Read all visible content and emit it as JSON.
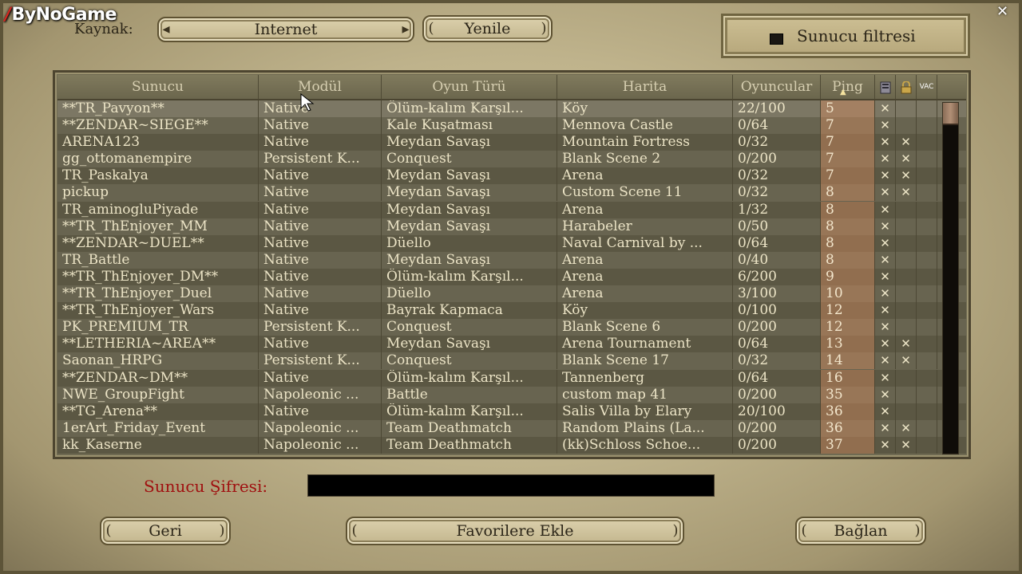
{
  "watermark": "ByNoGame",
  "window_close_glyph": "✕",
  "header": {
    "source_label": "Kaynak:",
    "source_value": "Internet",
    "refresh_label": "Yenile",
    "filter_label": "Sunucu filtresi",
    "filter_checked": true
  },
  "table": {
    "columns": {
      "server": "Sunucu",
      "module": "Modül",
      "game_type": "Oyun Türü",
      "map": "Harita",
      "players": "Oyuncular",
      "ping": "Ping",
      "vac": "VAC"
    },
    "sort_column": "ping",
    "rows": [
      {
        "server": "**TR_Pavyon**",
        "module": "Native",
        "game_type": "Ölüm-kalım Karşıl...",
        "map": "Köy",
        "players": "22/100",
        "ping": "5",
        "col1": "✕",
        "col2": "",
        "col3": ""
      },
      {
        "server": "**ZENDAR~SIEGE**",
        "module": "Native",
        "game_type": "Kale Kuşatması",
        "map": "Mennova Castle",
        "players": "0/64",
        "ping": "7",
        "col1": "✕",
        "col2": "",
        "col3": ""
      },
      {
        "server": "ARENA123",
        "module": "Native",
        "game_type": "Meydan Savaşı",
        "map": "Mountain Fortress",
        "players": "0/32",
        "ping": "7",
        "col1": "✕",
        "col2": "✕",
        "col3": ""
      },
      {
        "server": "gg_ottomanempire",
        "module": "Persistent K...",
        "game_type": "Conquest",
        "map": "Blank Scene 2",
        "players": "0/200",
        "ping": "7",
        "col1": "✕",
        "col2": "✕",
        "col3": ""
      },
      {
        "server": "TR_Paskalya",
        "module": "Native",
        "game_type": "Meydan Savaşı",
        "map": "Arena",
        "players": "0/32",
        "ping": "7",
        "col1": "✕",
        "col2": "✕",
        "col3": ""
      },
      {
        "server": "pickup",
        "module": "Native",
        "game_type": "Meydan Savaşı",
        "map": "Custom Scene 11",
        "players": "0/32",
        "ping": "8",
        "col1": "✕",
        "col2": "✕",
        "col3": ""
      },
      {
        "server": "TR_aminogluPiyade",
        "module": "Native",
        "game_type": "Meydan Savaşı",
        "map": "Arena",
        "players": "1/32",
        "ping": "8",
        "col1": "✕",
        "col2": "",
        "col3": ""
      },
      {
        "server": "**TR_ThEnjoyer_MM",
        "module": "Native",
        "game_type": "Meydan Savaşı",
        "map": "Harabeler",
        "players": "0/50",
        "ping": "8",
        "col1": "✕",
        "col2": "",
        "col3": ""
      },
      {
        "server": "**ZENDAR~DUEL**",
        "module": "Native",
        "game_type": "Düello",
        "map": "Naval Carnival by ...",
        "players": "0/64",
        "ping": "8",
        "col1": "✕",
        "col2": "",
        "col3": ""
      },
      {
        "server": "TR_Battle",
        "module": "Native",
        "game_type": "Meydan Savaşı",
        "map": "Arena",
        "players": "0/40",
        "ping": "8",
        "col1": "✕",
        "col2": "",
        "col3": ""
      },
      {
        "server": "**TR_ThEnjoyer_DM**",
        "module": "Native",
        "game_type": "Ölüm-kalım Karşıl...",
        "map": "Arena",
        "players": "6/200",
        "ping": "9",
        "col1": "✕",
        "col2": "",
        "col3": ""
      },
      {
        "server": "**TR_ThEnjoyer_Duel",
        "module": "Native",
        "game_type": "Düello",
        "map": "Arena",
        "players": "3/100",
        "ping": "10",
        "col1": "✕",
        "col2": "",
        "col3": ""
      },
      {
        "server": "**TR_ThEnjoyer_Wars",
        "module": "Native",
        "game_type": "Bayrak Kapmaca",
        "map": "Köy",
        "players": "0/100",
        "ping": "12",
        "col1": "✕",
        "col2": "",
        "col3": ""
      },
      {
        "server": "PK_PREMIUM_TR",
        "module": "Persistent K...",
        "game_type": "Conquest",
        "map": "Blank Scene 6",
        "players": "0/200",
        "ping": "12",
        "col1": "✕",
        "col2": "",
        "col3": ""
      },
      {
        "server": "**LETHERIA~AREA**",
        "module": "Native",
        "game_type": "Meydan Savaşı",
        "map": "Arena Tournament",
        "players": "0/64",
        "ping": "13",
        "col1": "✕",
        "col2": "✕",
        "col3": ""
      },
      {
        "server": "Saonan_HRPG",
        "module": "Persistent K...",
        "game_type": "Conquest",
        "map": "Blank Scene 17",
        "players": "0/32",
        "ping": "14",
        "col1": "✕",
        "col2": "✕",
        "col3": ""
      },
      {
        "server": "**ZENDAR~DM**",
        "module": "Native",
        "game_type": "Ölüm-kalım Karşıl...",
        "map": "Tannenberg",
        "players": "0/64",
        "ping": "16",
        "col1": "✕",
        "col2": "",
        "col3": ""
      },
      {
        "server": "NWE_GroupFight",
        "module": "Napoleonic ...",
        "game_type": "Battle",
        "map": "custom map 41",
        "players": "0/200",
        "ping": "35",
        "col1": "✕",
        "col2": "",
        "col3": ""
      },
      {
        "server": "**TG_Arena**",
        "module": "Native",
        "game_type": "Ölüm-kalım Karşıl...",
        "map": "Salis Villa by Elary",
        "players": "20/100",
        "ping": "36",
        "col1": "✕",
        "col2": "",
        "col3": ""
      },
      {
        "server": "1erArt_Friday_Event",
        "module": "Napoleonic ...",
        "game_type": "Team Deathmatch",
        "map": "Random Plains (La...",
        "players": "0/200",
        "ping": "36",
        "col1": "✕",
        "col2": "✕",
        "col3": ""
      },
      {
        "server": "kk_Kaserne",
        "module": "Napoleonic ...",
        "game_type": "Team Deathmatch",
        "map": "(kk)Schloss Schoe...",
        "players": "0/200",
        "ping": "37",
        "col1": "✕",
        "col2": "✕",
        "col3": ""
      }
    ]
  },
  "footer": {
    "password_label": "Sunucu Şifresi:",
    "password_value": "",
    "back_label": "Geri",
    "favorites_label": "Favorilere Ekle",
    "connect_label": "Bağlan"
  }
}
